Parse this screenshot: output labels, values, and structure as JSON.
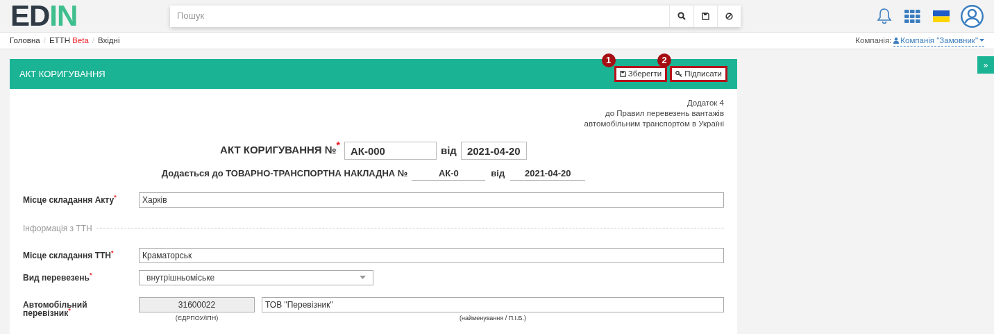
{
  "logo": {
    "dark": "ED",
    "accent": "IN"
  },
  "search": {
    "placeholder": "Пошук"
  },
  "breadcrumbs": [
    {
      "label": "Головна"
    },
    {
      "label": "ЕТТН",
      "badge": "Beta"
    },
    {
      "label": "Вхідні"
    }
  ],
  "breadcrumb_separators": [
    "/",
    "/"
  ],
  "company": {
    "label": "Компанія:",
    "value": "Компанія \"Замовник\""
  },
  "side_toggle": "»",
  "card": {
    "title": "АКТ КОРИГУВАННЯ",
    "actions": [
      {
        "kind": "save",
        "label": "Зберегти",
        "callout": "1"
      },
      {
        "kind": "sign",
        "label": "Підписати",
        "callout": "2"
      }
    ],
    "annex": [
      "Додаток 4",
      "до Правил перевезень вантажів",
      "автомобільним транспортом в Україні"
    ],
    "heading": {
      "label": "АКТ КОРИГУВАННЯ №",
      "mark": "*",
      "number": "АК-000",
      "date_label": "від",
      "date": "2021-04-20"
    },
    "attached": {
      "label": "Додається до ТОВАРНО-ТРАНСПОРТНА НАКЛАДНА №",
      "number": "АК-0",
      "date_label": "від",
      "date": "2021-04-20"
    },
    "rows": [
      {
        "kind": "text",
        "label": "Місце складання Акту",
        "mark": "*",
        "value": "Харків"
      },
      {
        "kind": "divider",
        "label": "Інформація з ТТН"
      },
      {
        "kind": "text",
        "label": "Місце складання ТТН",
        "mark": "*",
        "value": "Краматорськ"
      },
      {
        "kind": "select",
        "label": "Вид перевезень",
        "mark": "*",
        "value": "внутрішньоміське"
      },
      {
        "kind": "carrier",
        "label": "Автомобільний перевізник",
        "mark": "*",
        "code": "31600022",
        "code_caption": "(ЄДРПОУ/ІПН)",
        "value": "ТОВ \"Перевізник\"",
        "value_caption": "(найменування / П.І.Б.)"
      }
    ]
  }
}
